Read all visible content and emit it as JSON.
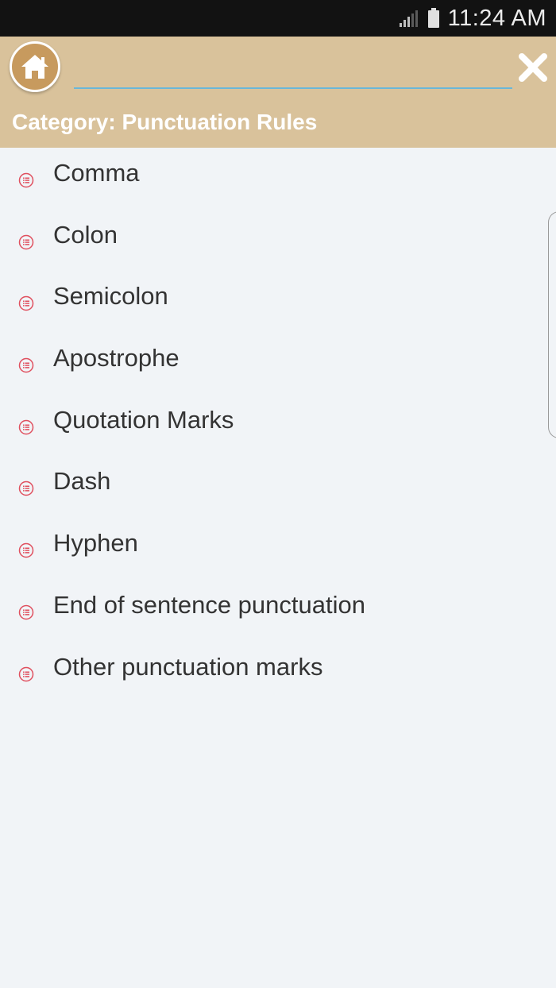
{
  "status_bar": {
    "time": "11:24 AM",
    "icons": [
      "signal-icon",
      "battery-icon"
    ]
  },
  "header": {
    "search": {
      "value": "",
      "placeholder": ""
    },
    "category_title": "Category: Punctuation Rules",
    "icons": [
      "home-icon",
      "close-icon"
    ]
  },
  "topics": [
    {
      "label": "Comma"
    },
    {
      "label": "Colon"
    },
    {
      "label": "Semicolon"
    },
    {
      "label": "Apostrophe"
    },
    {
      "label": "Quotation Marks"
    },
    {
      "label": "Dash"
    },
    {
      "label": "Hyphen"
    },
    {
      "label": "End of sentence punctuation"
    },
    {
      "label": "Other punctuation marks"
    }
  ],
  "colors": {
    "header_bg": "#d9c29b",
    "status_bg": "#121212",
    "page_bg": "#f1f4f7",
    "bullet": "#e0505f",
    "input_underline": "#6ab7d9"
  }
}
